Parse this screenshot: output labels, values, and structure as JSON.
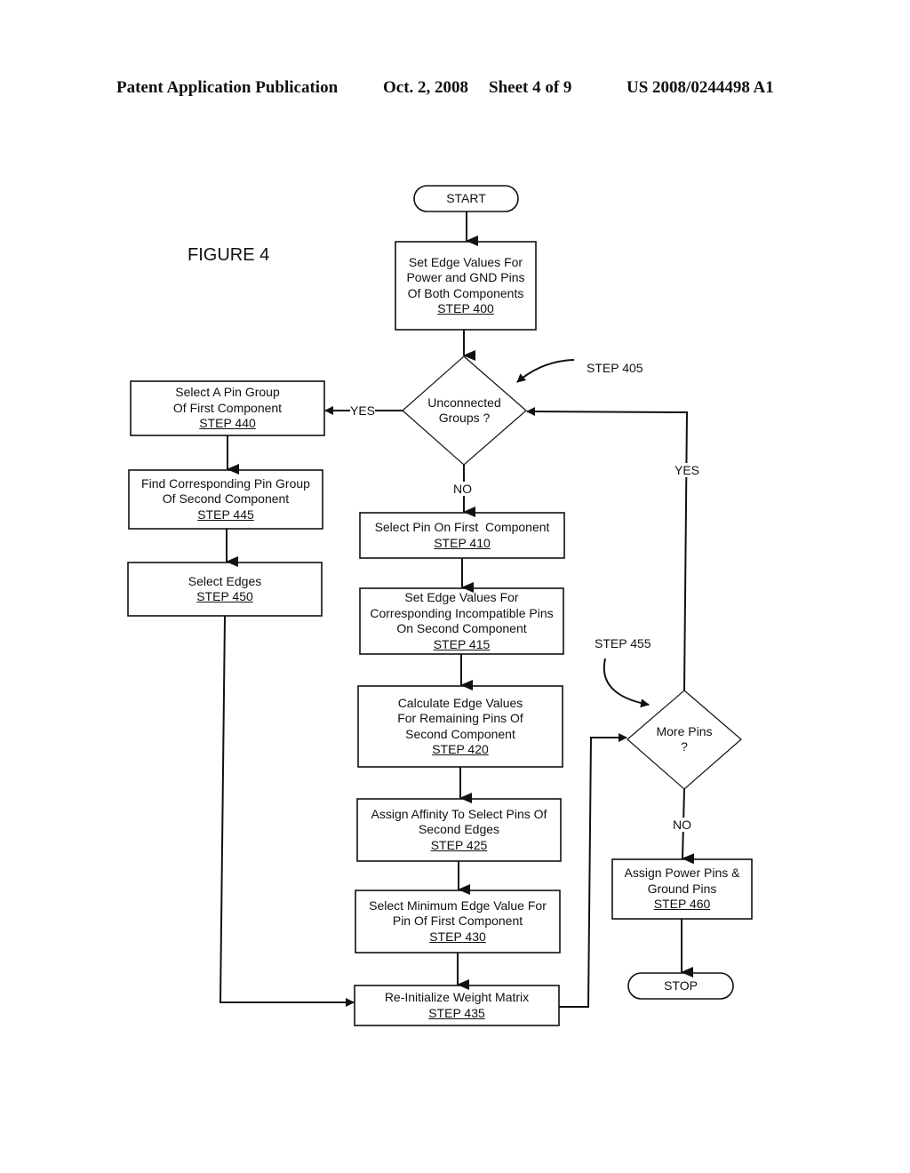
{
  "header": {
    "publication": "Patent Application Publication",
    "date": "Oct. 2, 2008",
    "sheet": "Sheet 4 of 9",
    "number": "US 2008/0244498 A1"
  },
  "figure_label": "FIGURE 4",
  "nodes": {
    "start": {
      "type": "terminal",
      "text": "START"
    },
    "s400": {
      "type": "process",
      "lines": [
        "Set Edge Values For",
        "Power and GND Pins",
        "Of Both Components"
      ],
      "step": "STEP 400"
    },
    "s405": {
      "type": "decision",
      "lines": [
        "Unconnected",
        "Groups ?"
      ],
      "callout": "STEP 405"
    },
    "s410": {
      "type": "process",
      "lines": [
        "Select Pin On First  Component"
      ],
      "step": "STEP 410"
    },
    "s415": {
      "type": "process",
      "lines": [
        "Set Edge Values For",
        "Corresponding Incompatible Pins",
        "On Second Component"
      ],
      "step": "STEP 415"
    },
    "s420": {
      "type": "process",
      "lines": [
        "Calculate Edge Values",
        "For Remaining Pins Of",
        "Second Component"
      ],
      "step": "STEP 420"
    },
    "s425": {
      "type": "process",
      "lines": [
        "Assign Affinity To Select Pins Of",
        "Second Edges"
      ],
      "step": "STEP 425"
    },
    "s430": {
      "type": "process",
      "lines": [
        "Select Minimum Edge Value For",
        "Pin Of First Component"
      ],
      "step": "STEP 430"
    },
    "s435": {
      "type": "process",
      "lines": [
        "Re-Initialize Weight Matrix"
      ],
      "step": "STEP 435"
    },
    "s440": {
      "type": "process",
      "lines": [
        "Select A Pin Group",
        "Of First Component"
      ],
      "step": "STEP 440"
    },
    "s445": {
      "type": "process",
      "lines": [
        "Find Corresponding Pin Group",
        "Of Second Component"
      ],
      "step": "STEP 445"
    },
    "s450": {
      "type": "process",
      "lines": [
        "Select Edges"
      ],
      "step": "STEP 450"
    },
    "s455": {
      "type": "decision",
      "lines": [
        "More Pins",
        "?"
      ],
      "callout": "STEP 455"
    },
    "s460": {
      "type": "process",
      "lines": [
        "Assign Power Pins &",
        "Ground Pins"
      ],
      "step": "STEP 460"
    },
    "stop": {
      "type": "terminal",
      "text": "STOP"
    }
  },
  "edge_labels": {
    "s405_yes": "YES",
    "s405_no": "NO",
    "s455_yes": "YES",
    "s455_no": "NO"
  },
  "edges": [
    {
      "from": "start",
      "to": "s400"
    },
    {
      "from": "s400",
      "to": "s405"
    },
    {
      "from": "s405",
      "to": "s440",
      "label": "YES"
    },
    {
      "from": "s405",
      "to": "s410",
      "label": "NO"
    },
    {
      "from": "s440",
      "to": "s445"
    },
    {
      "from": "s445",
      "to": "s450"
    },
    {
      "from": "s450",
      "to": "s435"
    },
    {
      "from": "s410",
      "to": "s415"
    },
    {
      "from": "s415",
      "to": "s420"
    },
    {
      "from": "s420",
      "to": "s425"
    },
    {
      "from": "s425",
      "to": "s430"
    },
    {
      "from": "s430",
      "to": "s435"
    },
    {
      "from": "s435",
      "to": "s455"
    },
    {
      "from": "s455",
      "to": "s405",
      "label": "YES"
    },
    {
      "from": "s455",
      "to": "s460",
      "label": "NO"
    },
    {
      "from": "s460",
      "to": "stop"
    }
  ]
}
